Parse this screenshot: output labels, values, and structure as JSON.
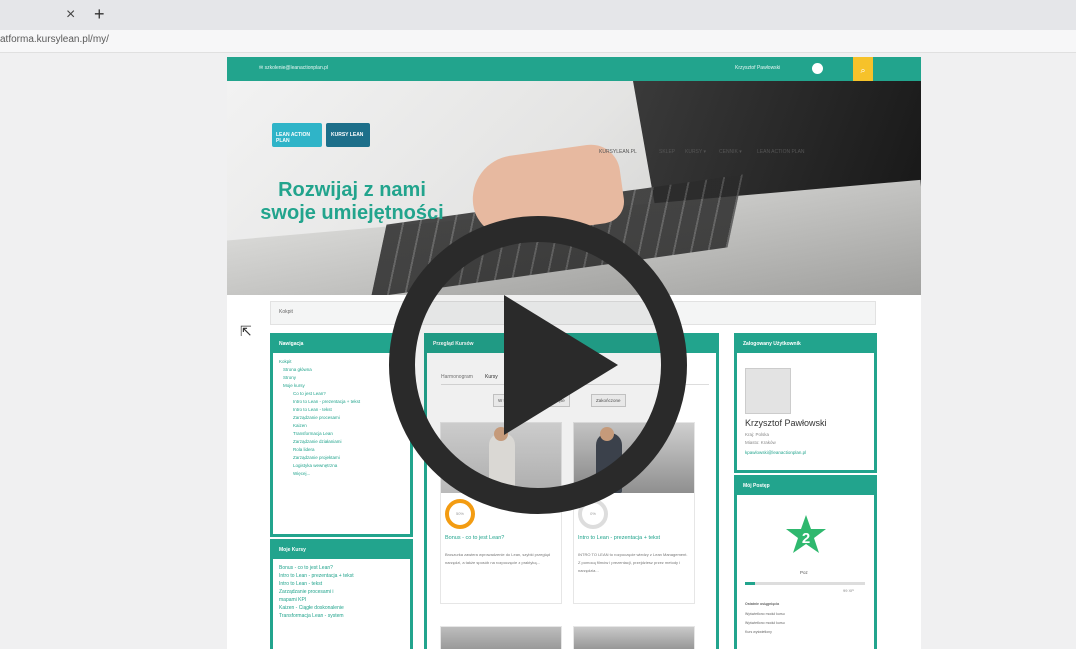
{
  "browser": {
    "tab_close": "×",
    "new_tab": "+",
    "url": "atforma.kursylean.pl/my/"
  },
  "site": {
    "topbar_email": "✉ szkolenie@leanactionplan.pl",
    "topbar_user": "Krzysztof Pawłowski",
    "nav": [
      "KURSYLEAN.PL",
      "SKLEP",
      "KURSY ▾",
      "CENNIK ▾",
      "LEAN ACTION PLAN"
    ],
    "logo_left": "LEAN ACTION PLAN",
    "logo_right": "KURSY LEAN",
    "hero_title": "Rozwijaj z nami swoje umiejętności",
    "breadcrumb": "Kokpit"
  },
  "navigation_block": {
    "title": "Nawigacja",
    "items": [
      "Kokpit",
      "Strona główna",
      "Strony",
      "Moje kursy",
      "Co to jest Lean?",
      "Intro to Lean - prezentacja + tekst",
      "Intro to Lean - tekst",
      "Zarządzanie procesami",
      "Kaizen",
      "Transformacja Lean",
      "Zarządzanie działaniami",
      "Rola lidera",
      "Zarządzanie projektami",
      "Logistyka wewnętrzna",
      "Więcej..."
    ]
  },
  "my_courses_block": {
    "title": "Moje Kursy",
    "items": [
      "Bonus - co to jest Lean?",
      "Intro to Lean - prezentacja + tekst",
      "Intro to Lean - tekst",
      "Zarządzanie procesami i",
      "mapami KPI",
      "Kaizen - Ciągłe doskonalenie",
      "Transformacja Lean - system"
    ]
  },
  "overview_block": {
    "title": "Przegląd Kursów",
    "tabs": [
      "Harmonogram",
      "Kursy"
    ],
    "filters": [
      "W toku",
      "Nierozpoczęte",
      "Zakończone"
    ],
    "courses": [
      {
        "progress": "50%",
        "title": "Bonus - co to jest Lean?",
        "desc": "Broszurka zawiera wprowadzenie do Lean, szybki przegląd narzędzi, a także sposób na rozpoczęcie z praktyką..."
      },
      {
        "progress": "0%",
        "title": "Intro to Lean - prezentacja + tekst",
        "desc": "INTRO TO LEAN to rozpoczęcie wiedzy z Lean Management. Z pomocą filmów i prezentacji, przejdziesz przez metody i narzędzia..."
      }
    ]
  },
  "user_block": {
    "title": "Zalogowany Użytkownik",
    "name": "Krzysztof Pawłowski",
    "country": "Kraj: Polska",
    "city": "Miasto: Kraków",
    "email": "kpawlowski@leanactionplan.pl"
  },
  "progress_block": {
    "title": "Mój Postęp",
    "level": "2",
    "level_label": "Poz",
    "xp": "99 XP",
    "recent_title": "Ostatnie osiągnięcia",
    "recent": [
      "Wyświetlono moduł kursu",
      "Wyświetlono moduł kursu",
      "Kurs wyświetlony"
    ]
  },
  "colors": {
    "accent": "#22a48d",
    "topbar_button": "#f6c22a",
    "progress_orange": "#f39c12",
    "star": "#2fb86e"
  },
  "overlay": {
    "icon": "play-icon"
  }
}
